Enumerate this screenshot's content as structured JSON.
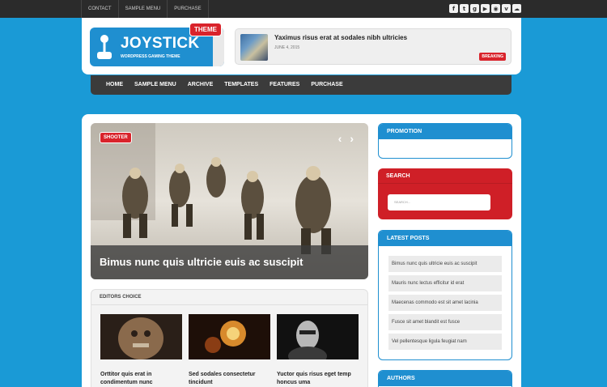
{
  "topbar": {
    "links": [
      "CONTACT",
      "SAMPLE MENU",
      "PURCHASE"
    ],
    "social_icons": [
      "facebook-icon",
      "twitter-icon",
      "google-plus-icon",
      "youtube-icon",
      "rss-icon",
      "vimeo-icon",
      "soundcloud-icon"
    ]
  },
  "header": {
    "logo_title": "JOYSTICK",
    "logo_subtitle": "WORDPRESS GAMING THEME",
    "logo_badge": "THEME",
    "breaking": {
      "title": "Yaximus risus erat at sodales nibh ultricies",
      "date": "JUNE 4, 2015",
      "tag": "BREAKING"
    }
  },
  "nav": {
    "items": [
      "HOME",
      "SAMPLE MENU",
      "ARCHIVE",
      "TEMPLATES",
      "FEATURES",
      "PURCHASE"
    ]
  },
  "slider": {
    "tag": "SHOOTER",
    "prev": "‹",
    "next": "›",
    "caption": "Bimus nunc quis ultricie euis ac suscipit"
  },
  "editors": {
    "heading": "EDITORS CHOICE",
    "items": [
      {
        "title": "Orttitor quis erat in condimentum nunc"
      },
      {
        "title": "Sed sodales consectetur tincidunt"
      },
      {
        "title": "Yuctor quis risus eget temp honcus uma"
      }
    ]
  },
  "sidebar": {
    "promotion": "PROMOTION",
    "search": {
      "heading": "SEARCH",
      "placeholder": "SEARCH..."
    },
    "latest": {
      "heading": "LATEST POSTS",
      "posts": [
        "Bimus nunc quis ultricie euis ac suscipit",
        "Mauris nunc lectus efficitur id erat",
        "Maecenas commodo est sit amet lacinia",
        "Fusce sit amet blandit est fusce",
        "Vel pellentesque ligula feugiat nam"
      ]
    },
    "authors": "AUTHORS"
  },
  "colors": {
    "background": "#1a9ad6",
    "accent_blue": "#1f8fd0",
    "accent_red": "#d9232b",
    "nav_dark": "#3b3b3b"
  }
}
